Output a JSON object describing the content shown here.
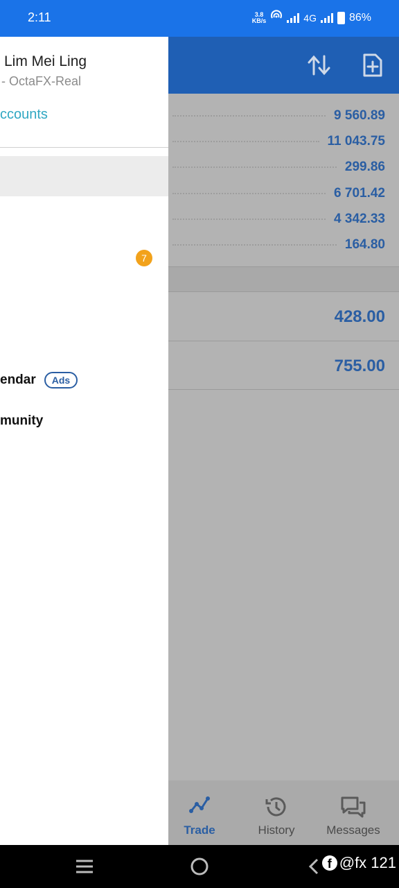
{
  "status_bar": {
    "time": "2:11",
    "net_speed_value": "3.8",
    "net_speed_unit": "KB/s",
    "network": "4G",
    "battery": "86%"
  },
  "header": {
    "sort_icon": "sort-arrows-icon",
    "new_order_icon": "add-document-icon"
  },
  "accounts_summary": {
    "values": [
      "9 560.89",
      "11 043.75",
      "299.86",
      "6 701.42",
      "4 342.33",
      "164.80"
    ]
  },
  "positions": {
    "values": [
      "428.00",
      "755.00"
    ]
  },
  "drawer": {
    "user_name": "Lim Mei Ling",
    "account_name": "- OctaFX-Real",
    "accounts_link": "ccounts",
    "notification_count": "7",
    "calendar_label": "endar",
    "ads_label": "Ads",
    "community_label": "munity"
  },
  "bottom_nav": {
    "items": [
      {
        "label": "Trade",
        "icon": "trade-chart-icon",
        "active": true
      },
      {
        "label": "History",
        "icon": "history-clock-icon",
        "active": false
      },
      {
        "label": "Messages",
        "icon": "messages-icon",
        "active": false
      }
    ]
  },
  "system_nav": {
    "watermark": "@fx 121"
  },
  "colors": {
    "status_bar": "#1a73e8",
    "header": "#1f5fb4",
    "accent_value": "#2a5ea3",
    "link": "#2fa7c2",
    "badge": "#f2a21b"
  }
}
